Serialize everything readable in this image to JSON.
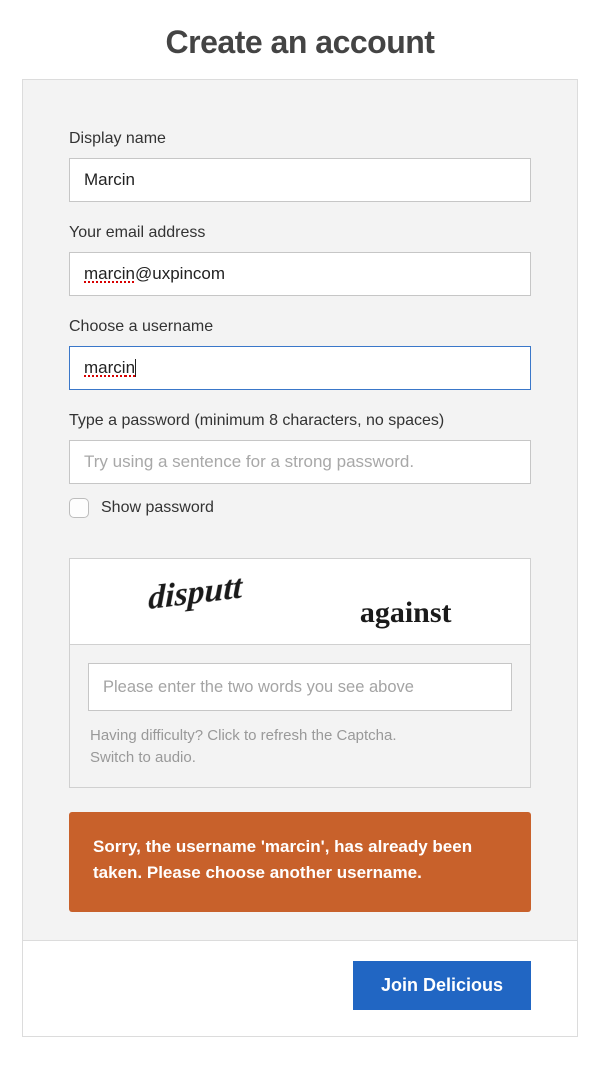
{
  "title": "Create an account",
  "fields": {
    "display_name": {
      "label": "Display name",
      "value": "Marcin"
    },
    "email": {
      "label": "Your email address",
      "value_part1": "marcin",
      "value_part2": "@uxpincom"
    },
    "username": {
      "label": "Choose a username",
      "value_part1": "marci",
      "value_part2": "n"
    },
    "password": {
      "label": "Type a password (minimum 8 characters, no spaces)",
      "placeholder": "Try using a sentence for a strong password."
    },
    "show_password_label": "Show password"
  },
  "captcha": {
    "word1": "disputt",
    "word2": "against",
    "placeholder": "Please enter the two words you see above",
    "help_line1": "Having difficulty? Click to refresh the Captcha.",
    "help_line2": "Switch to audio."
  },
  "error_message": "Sorry, the username 'marcin', has already been taken. Please choose another username.",
  "submit_label": "Join Delicious"
}
